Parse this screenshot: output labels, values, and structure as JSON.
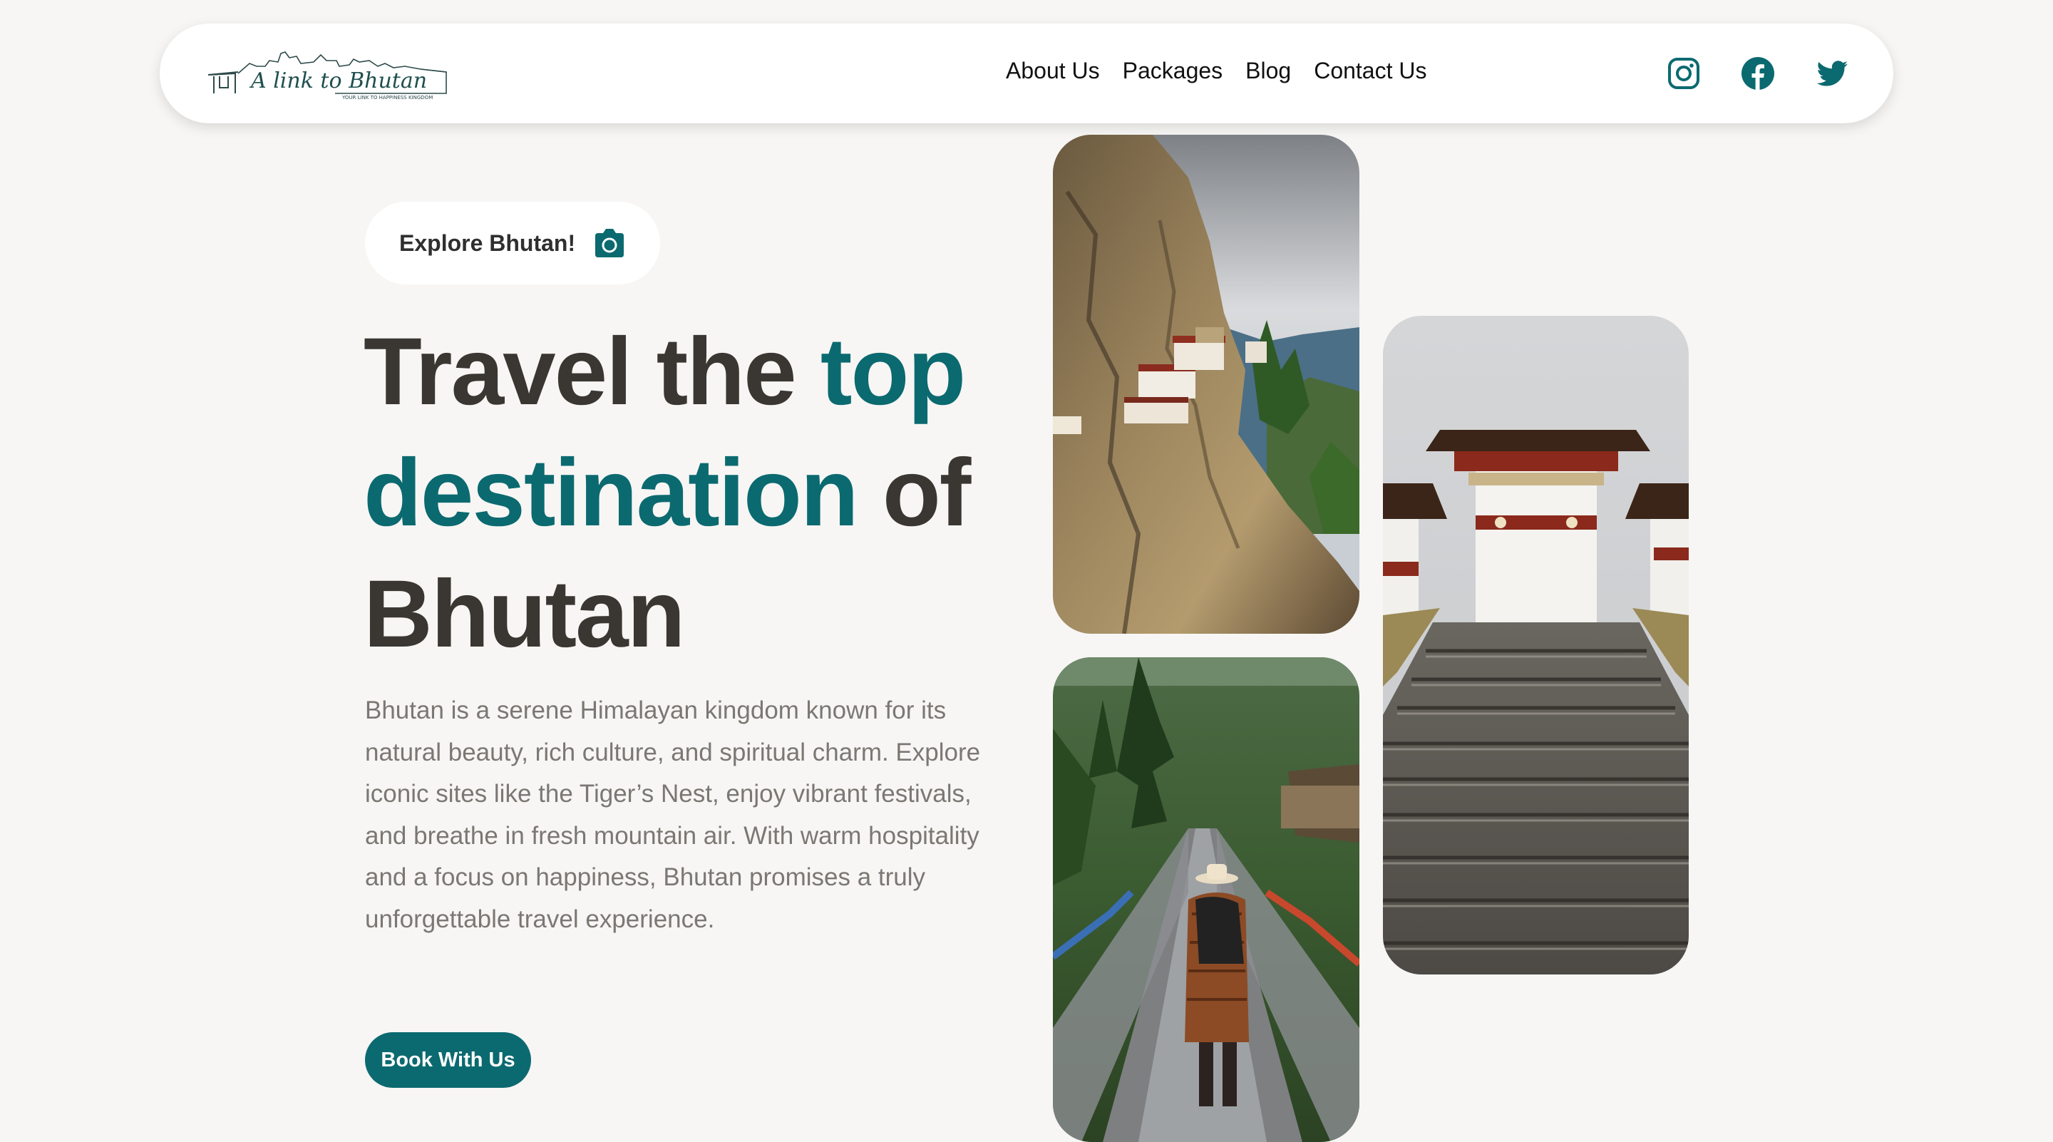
{
  "nav": {
    "logo_text": "A link to Bhutan",
    "logo_tagline": "YOUR LINK TO HAPPINESS KINGDOM",
    "links": [
      {
        "label": "About Us"
      },
      {
        "label": "Packages"
      },
      {
        "label": "Blog"
      },
      {
        "label": "Contact Us"
      }
    ],
    "socials": [
      "instagram-icon",
      "facebook-icon",
      "twitter-icon"
    ]
  },
  "hero": {
    "badge_label": "Explore Bhutan!",
    "badge_icon": "camera-icon",
    "headline_part1": "Travel the ",
    "headline_accent": "top destination",
    "headline_part2": " of Bhutan",
    "description": "Bhutan is a serene Himalayan kingdom known for its natural beauty, rich culture, and spiritual charm. Explore iconic sites like the Tiger’s Nest, enjoy vibrant festivals, and breathe in fresh mountain air. With warm hospitality and a focus on happiness, Bhutan promises a truly unforgettable travel experience.",
    "cta_label": "Book With Us"
  },
  "colors": {
    "accent": "#0b6a70",
    "heading": "#3a3733",
    "body_text": "#7b7874",
    "background": "#f7f6f4"
  }
}
